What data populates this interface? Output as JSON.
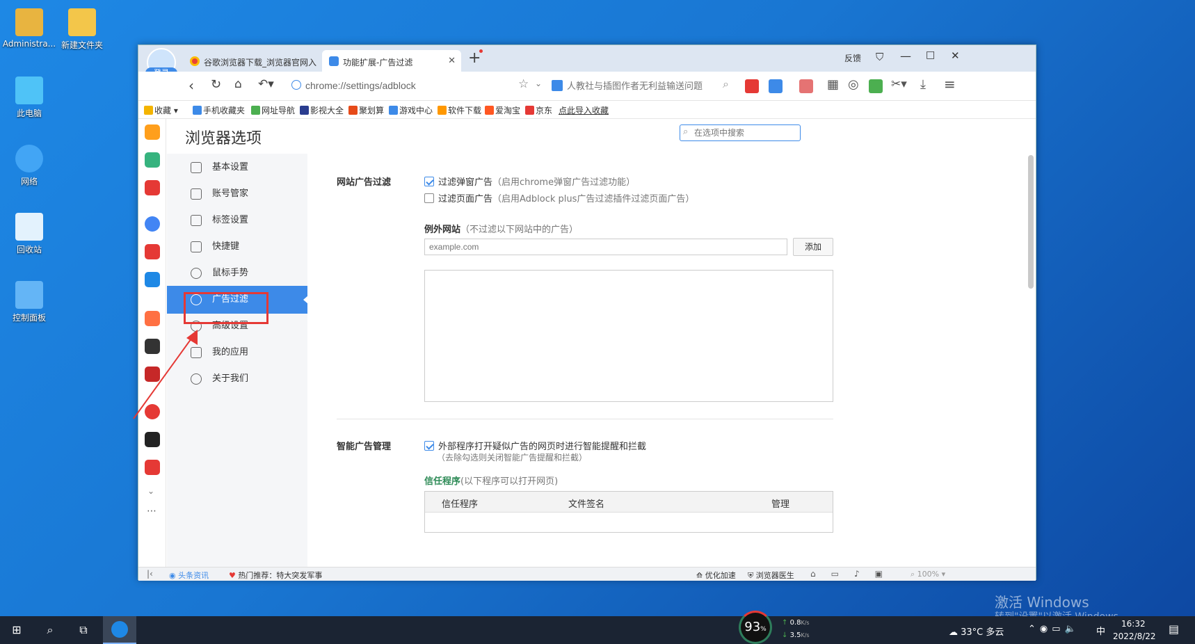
{
  "desktop": {
    "icons": [
      {
        "label": "Administra...",
        "color": "#e8b440"
      },
      {
        "label": "新建文件夹",
        "color": "#f3c64a"
      },
      {
        "label": "此电脑",
        "color": "#4fc3f7"
      },
      {
        "label": "网络",
        "color": "#42a5f5"
      },
      {
        "label": "回收站",
        "color": "#e3f2fd"
      },
      {
        "label": "控制面板",
        "color": "#64b5f6"
      }
    ],
    "activation_title": "激活 Windows",
    "activation_sub": "转到\"设置\"以激活 Windows。"
  },
  "browser": {
    "login_label": "登录",
    "tabs": [
      {
        "title": "谷歌浏览器下载_浏览器官网入",
        "active": false
      },
      {
        "title": "功能扩展-广告过滤",
        "active": true
      }
    ],
    "window_controls": {
      "feedback": "反馈"
    },
    "url": "chrome://settings/adblock",
    "search_placeholder": "人教社与插图作者无利益输送问题",
    "bookmarks": [
      {
        "label": "收藏",
        "color": "#f4b400"
      },
      {
        "label": "手机收藏夹",
        "color": "#3d8ae8"
      },
      {
        "label": "网址导航",
        "color": "#4caf50"
      },
      {
        "label": "影视大全",
        "color": "#2a3d8f"
      },
      {
        "label": "聚划算",
        "color": "#e64a19"
      },
      {
        "label": "游戏中心",
        "color": "#3d8ae8"
      },
      {
        "label": "软件下载",
        "color": "#ff9800"
      },
      {
        "label": "爱淘宝",
        "color": "#ff5722"
      },
      {
        "label": "京东",
        "color": "#e53935"
      },
      {
        "label": "点此导入收藏",
        "color": "transparent"
      }
    ],
    "sidebar_icon_colors": [
      "#ff9f1c",
      "#36b37e",
      "#e53935",
      "#4285f4",
      "#e53935",
      "#1e88e5",
      "#ff7043",
      "#333333",
      "#c62828",
      "#e53935",
      "#222222",
      "#e53935"
    ]
  },
  "settings": {
    "title": "浏览器选项",
    "search_placeholder": "在选项中搜索",
    "nav": [
      {
        "label": "基本设置",
        "active": false
      },
      {
        "label": "账号管家",
        "active": false
      },
      {
        "label": "标签设置",
        "active": false
      },
      {
        "label": "快捷键",
        "active": false
      },
      {
        "label": "鼠标手势",
        "active": false
      },
      {
        "label": "广告过滤",
        "active": true
      },
      {
        "label": "高级设置",
        "active": false
      },
      {
        "label": "我的应用",
        "active": false
      },
      {
        "label": "关于我们",
        "active": false
      }
    ],
    "site_filter": {
      "heading": "网站广告过滤",
      "opt1_label": "过滤弹窗广告",
      "opt1_note": "（启用chrome弹窗广告过滤功能）",
      "opt1_checked": true,
      "opt2_label": "过滤页面广告",
      "opt2_note": "（启用Adblock plus广告过滤插件过滤页面广告）",
      "opt2_checked": false,
      "exception_title": "例外网站",
      "exception_note": "（不过滤以下网站中的广告）",
      "input_placeholder": "example.com",
      "add_button": "添加"
    },
    "smart": {
      "heading": "智能广告管理",
      "opt_label": "外部程序打开疑似广告的网页时进行智能提醒和拦截",
      "opt_checked": true,
      "opt_sub": "（去除勾选则关闭智能广告提醒和拦截）",
      "trusted_title": "信任程序",
      "trusted_note": "(以下程序可以打开网页)",
      "columns": [
        "信任程序",
        "文件签名",
        "管理"
      ]
    }
  },
  "statusbar": {
    "news": "头条资讯",
    "hot": "热门推荐：特大突发军事",
    "speedup": "优化加速",
    "doctor": "浏览器医生",
    "zoom": "100%"
  },
  "taskbar": {
    "cpu_pct": "93",
    "cpu_unit": "%",
    "up": "0.8",
    "down": "3.5",
    "rate_unit": "K/s",
    "weather": "33°C 多云",
    "ime": "中",
    "time": "16:32",
    "date": "2022/8/22"
  },
  "annotation_color": "#e53935"
}
